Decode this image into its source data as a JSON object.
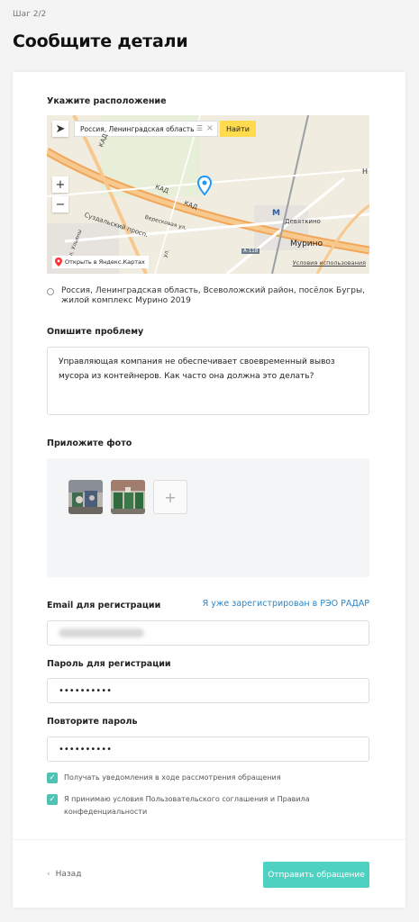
{
  "header": {
    "step": "Шаг 2/2",
    "title": "Сообщите детали"
  },
  "location": {
    "label": "Укажите расположение",
    "search_value": "Россия, Ленинградская область",
    "find_label": "Найти",
    "open_in_maps": "Открыть в Яндекс.Картах",
    "terms": "Условия использования",
    "map_labels": {
      "kad1": "КАД",
      "kad2": "КАД",
      "kad3": "КАД",
      "suzdal": "Суздальский просп.",
      "veresk": "Вересковая ул.",
      "devyatkino": "Девяткино",
      "murino": "Мурино",
      "road": "А-118",
      "n": "Н",
      "ul": "ул.",
      "ulitsa": "ул. Ульяны"
    },
    "address": "Россия, Ленинградская область, Всеволожский район, посёлок Бугры, жилой комплекс Мурино 2019"
  },
  "problem": {
    "label": "Опишите проблему",
    "text": "Управляющая компания не обеспечивает своевременный вывоз мусора из контейнеров. Как часто она должна это делать?"
  },
  "photos": {
    "label": "Приложите фото",
    "add_symbol": "+"
  },
  "registration": {
    "email_label": "Email для регистрации",
    "login_link": "Я уже зарегистрирован в РЭО РАДАР",
    "password_label": "Пароль для регистрации",
    "password_value": "••••••••••",
    "repeat_label": "Повторите пароль",
    "repeat_value": "••••••••••"
  },
  "consents": [
    {
      "label": "Получать уведомления в ходе рассмотрения обращения"
    },
    {
      "label": "Я принимаю условия Пользовательского соглашения и Правила конфеденциальности"
    }
  ],
  "footer": {
    "back_label": "Назад",
    "submit_label": "Отправить обращение"
  },
  "colors": {
    "accent": "#4fd1c1",
    "check": "#4fc3b1",
    "link": "#2b86c4",
    "map_find": "#ffdb4d"
  }
}
